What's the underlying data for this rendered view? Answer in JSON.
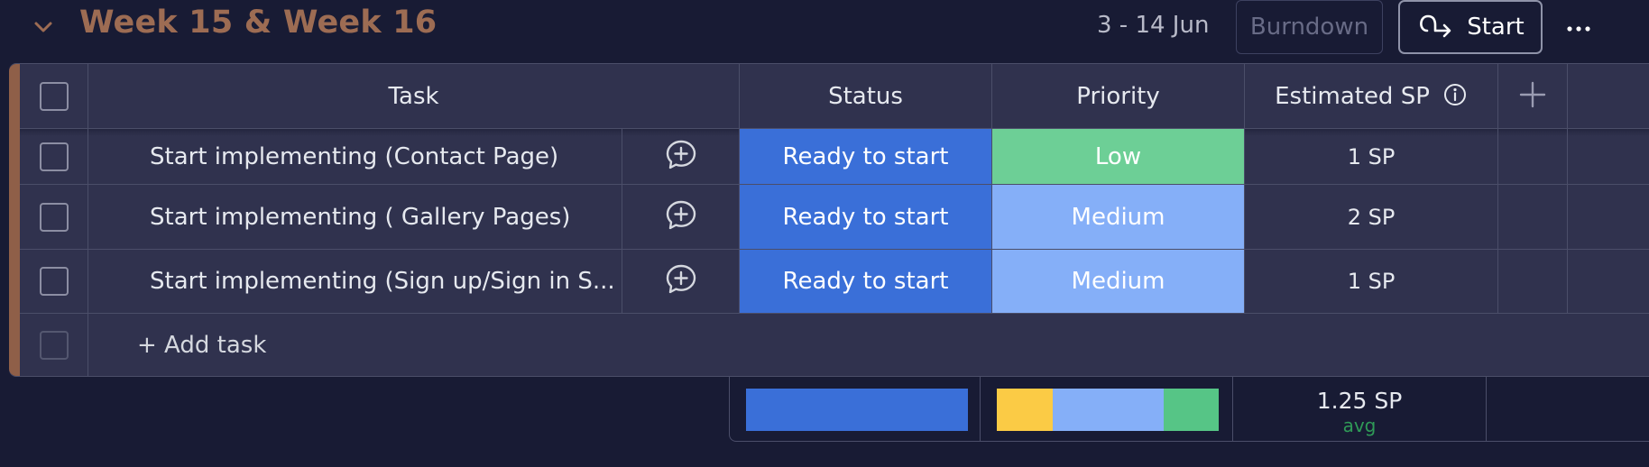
{
  "group": {
    "title": "Week 15 & Week 16",
    "date_range": "3 - 14 Jun",
    "burndown_label": "Burndown",
    "start_label": "Start",
    "more_label": "···"
  },
  "table": {
    "columns": {
      "task": "Task",
      "status": "Status",
      "priority": "Priority",
      "estimate": "Estimated SP"
    },
    "rows": [
      {
        "task": "Start implementing (Contact Page)",
        "status": "Ready to start",
        "priority": "Low",
        "estimate": "1 SP"
      },
      {
        "task": "Start implementing ( Gallery Pages)",
        "status": "Ready to start",
        "priority": "Medium",
        "estimate": "2 SP"
      },
      {
        "task": "Start implementing (Sign up/Sign in S...",
        "status": "Ready to start",
        "priority": "Medium",
        "estimate": "1 SP"
      }
    ],
    "add_task_label": "+ Add task"
  },
  "summary": {
    "status_distribution": [
      {
        "label": "Ready to start",
        "fraction": 1.0,
        "color": "#3a6fd8"
      }
    ],
    "priority_distribution": [
      {
        "label": "High",
        "fraction": 0.25,
        "color": "#fbcb45"
      },
      {
        "label": "Medium",
        "fraction": 0.5,
        "color": "#85aff8"
      },
      {
        "label": "Low",
        "fraction": 0.25,
        "color": "#56c586"
      }
    ],
    "estimate_avg": "1.25 SP",
    "estimate_avg_label": "avg"
  },
  "colors": {
    "background": "#181b34",
    "group_accent": "#9d6c53",
    "status_ready": "#3a6fd8",
    "priority_low": "#6dcf96",
    "priority_medium": "#85aff8"
  },
  "icons": {
    "collapse": "chevron-down-icon",
    "start": "curved-arrow-icon",
    "updates": "add-update-icon",
    "info": "info-icon",
    "add_column": "plus-icon"
  }
}
